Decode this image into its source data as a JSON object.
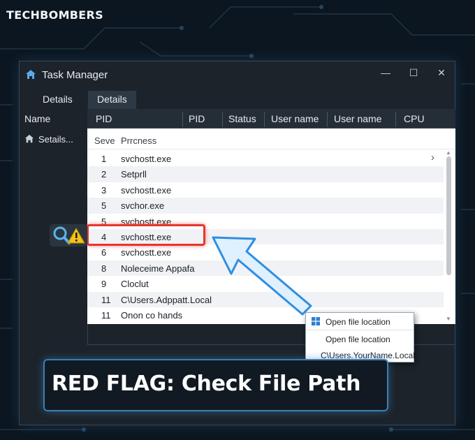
{
  "brand": {
    "name": "TECHBOMBERS"
  },
  "window": {
    "title": "Task Manager",
    "controls": {
      "minimize": "—",
      "maximize": "☐",
      "close": "✕"
    },
    "icon": "home-icon"
  },
  "tabs": [
    {
      "label": "Details",
      "active": false
    },
    {
      "label": "Details",
      "active": true
    }
  ],
  "left_pane": {
    "header": "Name",
    "item": {
      "label": "Setails...",
      "icon": "home-icon"
    }
  },
  "columns": [
    "PID",
    "PID",
    "Status",
    "User name",
    "User name",
    "CPU"
  ],
  "list": {
    "header": {
      "col1": "Seve",
      "col2": "Prrcness"
    },
    "expand_glyph": "›",
    "rows": [
      {
        "pid": "1",
        "name": "svchostt.exe"
      },
      {
        "pid": "2",
        "name": "Setprll"
      },
      {
        "pid": "3",
        "name": "svchostt.exe"
      },
      {
        "pid": "5",
        "name": "svchor.exe"
      },
      {
        "pid": "5",
        "name": "svchostt.exe"
      },
      {
        "pid": "4",
        "name": "svchostt.exe"
      },
      {
        "pid": "6",
        "name": "svchostt.exe"
      },
      {
        "pid": "8",
        "name": "Noleceime Appafa"
      },
      {
        "pid": "9",
        "name": "Cloclut"
      },
      {
        "pid": "11",
        "name": "C\\Users.Adppatt.Local"
      },
      {
        "pid": "11",
        "name": "Onon co hands"
      }
    ],
    "highlighted_index": 5
  },
  "context_menu": {
    "items": [
      {
        "label": "Open file location",
        "icon": "windows-icon"
      },
      {
        "label": "Open file location"
      },
      {
        "label": "C\\Users.YourName.Local"
      }
    ]
  },
  "banner": {
    "text": "RED FLAG: Check File Path"
  },
  "colors": {
    "background": "#0c1620",
    "window": "#1c232b",
    "highlight": "#e5372e",
    "arrow_fill": "#dff0ff",
    "arrow_stroke": "#2f8fe0",
    "banner_border": "#3c7fb0",
    "warning": "#f3c316"
  }
}
